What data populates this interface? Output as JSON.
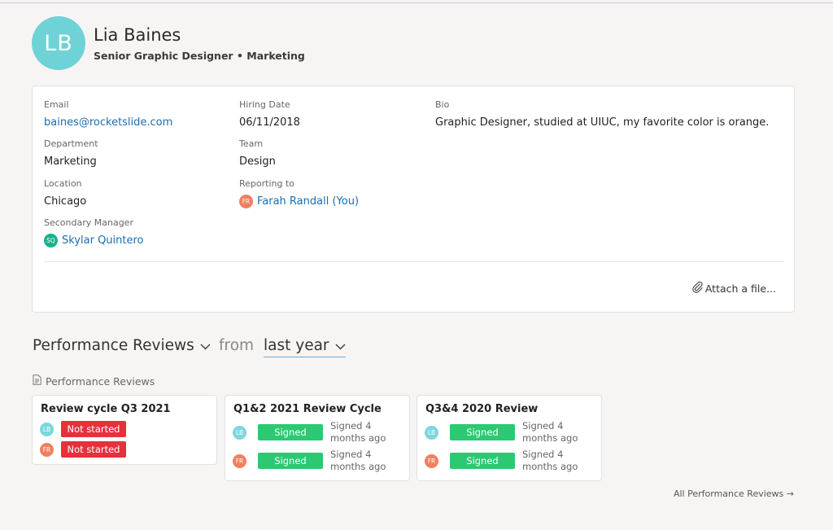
{
  "profile": {
    "initials": "LB",
    "name": "Lia Baines",
    "subtitle": "Senior Graphic Designer • Marketing",
    "avatar_color": "#6fd2d6"
  },
  "details": {
    "email_label": "Email",
    "email": "baines@rocketslide.com",
    "hiring_date_label": "Hiring Date",
    "hiring_date": "06/11/2018",
    "bio_label": "Bio",
    "bio": "Graphic Designer, studied at UIUC, my favorite color is orange.",
    "department_label": "Department",
    "department": "Marketing",
    "team_label": "Team",
    "team": "Design",
    "location_label": "Location",
    "location": "Chicago",
    "reporting_label": "Reporting to",
    "reporting_initials": "FR",
    "reporting_name": "Farah Randall (You)",
    "secondary_label": "Secondary Manager",
    "secondary_initials": "SQ",
    "secondary_name": "Skylar Quintero",
    "attach_label": "Attach a file..."
  },
  "reviews_section": {
    "title": "Performance Reviews",
    "from_label": "from",
    "period": "last year",
    "sub_label": "Performance Reviews",
    "all_link": "All Performance Reviews →",
    "cards": [
      {
        "title": "Review cycle Q3 2021",
        "rows": [
          {
            "initials": "LB",
            "status": "Not started"
          },
          {
            "initials": "FR",
            "status": "Not started"
          }
        ]
      },
      {
        "title": "Q1&2 2021 Review Cycle",
        "rows": [
          {
            "initials": "LB",
            "status": "Signed",
            "when": "Signed 4 months ago"
          },
          {
            "initials": "FR",
            "status": "Signed",
            "when": "Signed 4 months ago"
          }
        ]
      },
      {
        "title": "Q3&4 2020 Review",
        "rows": [
          {
            "initials": "LB",
            "status": "Signed",
            "when": "Signed 4 months ago"
          },
          {
            "initials": "FR",
            "status": "Signed",
            "when": "Signed 4 months ago"
          }
        ]
      }
    ]
  },
  "colors": {
    "link": "#1a6eb0",
    "not_started": "#e6303c",
    "signed": "#2cc872",
    "fr_avatar": "#f08060",
    "sq_avatar": "#1ab08c",
    "lb_avatar": "#7dd6dc"
  }
}
